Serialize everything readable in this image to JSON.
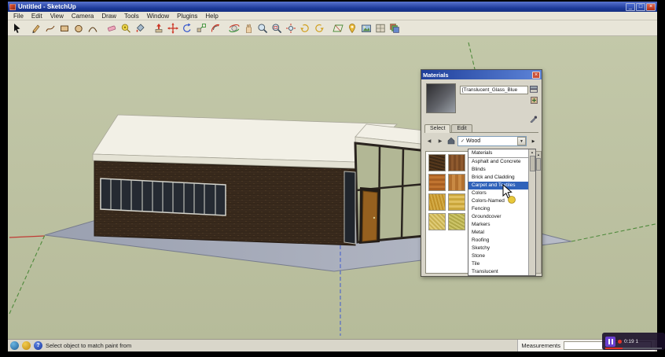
{
  "window": {
    "title": "Untitled - SketchUp"
  },
  "menu": {
    "items": [
      "File",
      "Edit",
      "View",
      "Camera",
      "Draw",
      "Tools",
      "Window",
      "Plugins",
      "Help"
    ]
  },
  "toolbar": {
    "tools": [
      "select",
      "line",
      "freehand",
      "rectangle",
      "circle",
      "arc",
      "eraser",
      "tape-measure",
      "paint-bucket",
      "push-pull",
      "move",
      "rotate",
      "scale",
      "offset",
      "orbit",
      "pan",
      "zoom",
      "zoom-window",
      "zoom-extents",
      "previous-view",
      "next-view",
      "section-plane",
      "add-location",
      "photo-textures",
      "styles",
      "layers"
    ]
  },
  "materials_dialog": {
    "title": "Materials",
    "material_name": "[Translucent_Glass_Blue",
    "tabs": [
      "Select",
      "Edit"
    ],
    "collection_combo": {
      "value": "Wood"
    },
    "dropdown": {
      "items": [
        "Materials",
        "Asphalt and Concrete",
        "Blinds",
        "Brick and Cladding",
        "Carpet and Textiles",
        "Colors",
        "Colors-Named",
        "Fencing",
        "Groundcover",
        "Markers",
        "Metal",
        "Roofing",
        "Sketchy",
        "Stone",
        "Tile",
        "Translucent"
      ],
      "selected": "Carpet and Textiles",
      "selected_index": 4
    }
  },
  "status_bar": {
    "hint": "Select object to match paint from",
    "measurements_label": "Measurements",
    "measurements_value": ""
  },
  "video_overlay": {
    "time": "0:19 1"
  },
  "colors": {
    "selection_blue": "#2f62ba",
    "titlebar_blue": "#1d3a9a",
    "sky_green": "#bcc1a1",
    "ground_gray": "#a6aab6",
    "wall_brown": "#3a2b1e",
    "roof_white": "#f2f0e6",
    "close_red": "#c94f38"
  }
}
